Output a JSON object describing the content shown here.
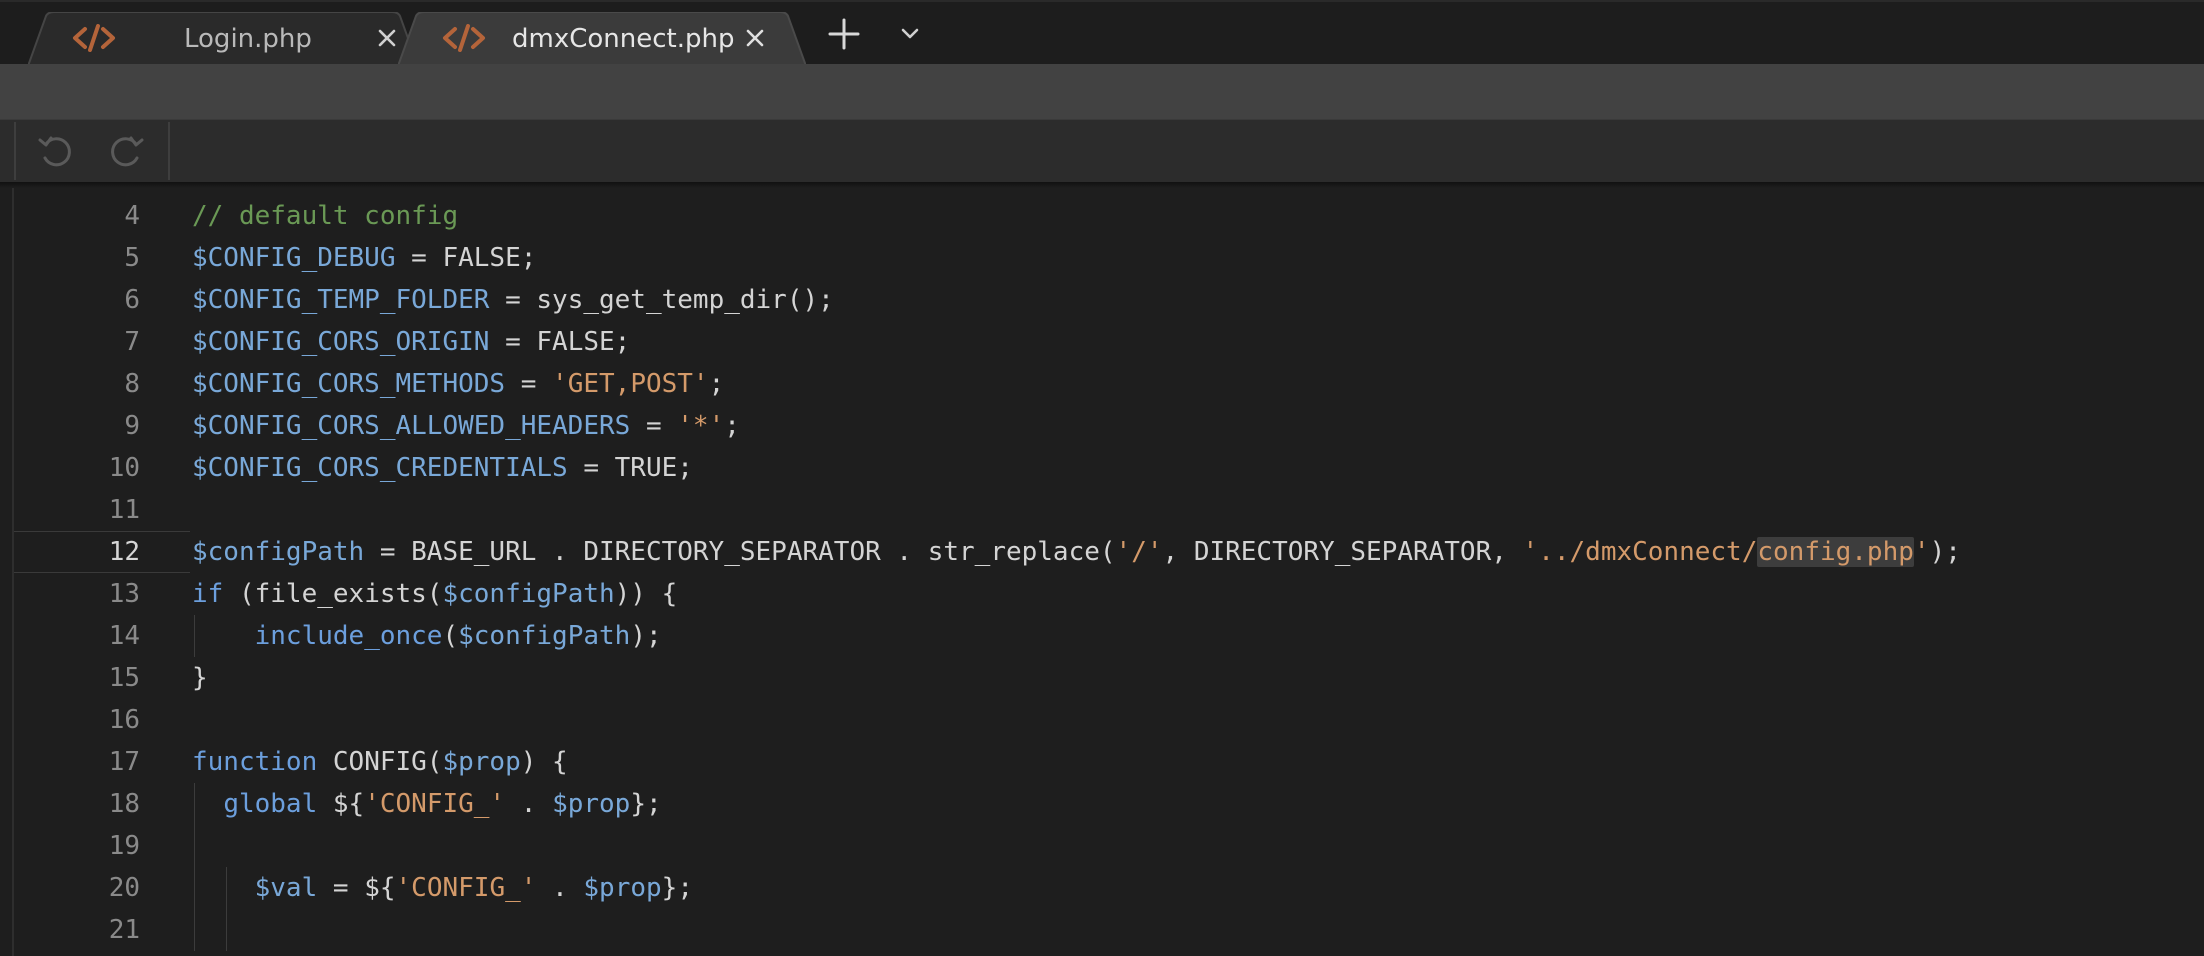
{
  "tabs": [
    {
      "title": "Login.php",
      "icon": "code-file-icon",
      "active": false
    },
    {
      "title": "dmxConnect.php",
      "icon": "code-file-icon",
      "active": true
    }
  ],
  "colors": {
    "icon_orange": "#b4643a",
    "comment": "#6a9955",
    "variable": "#79a8d8",
    "string": "#d49a6a",
    "keyword": "#6c9fdd",
    "text": "#d4d4d4"
  },
  "editor": {
    "active_line": 12,
    "lines": [
      {
        "number": "4",
        "tokens": [
          {
            "t": "// default config",
            "c": "comment"
          }
        ]
      },
      {
        "number": "5",
        "tokens": [
          {
            "t": "$CONFIG_DEBUG",
            "c": "var"
          },
          {
            "t": " = FALSE;",
            "c": "plain"
          }
        ]
      },
      {
        "number": "6",
        "tokens": [
          {
            "t": "$CONFIG_TEMP_FOLDER",
            "c": "var"
          },
          {
            "t": " = sys_get_temp_dir();",
            "c": "plain"
          }
        ]
      },
      {
        "number": "7",
        "tokens": [
          {
            "t": "$CONFIG_CORS_ORIGIN",
            "c": "var"
          },
          {
            "t": " = FALSE;",
            "c": "plain"
          }
        ]
      },
      {
        "number": "8",
        "tokens": [
          {
            "t": "$CONFIG_CORS_METHODS",
            "c": "var"
          },
          {
            "t": " = ",
            "c": "plain"
          },
          {
            "t": "'GET,POST'",
            "c": "str"
          },
          {
            "t": ";",
            "c": "plain"
          }
        ]
      },
      {
        "number": "9",
        "tokens": [
          {
            "t": "$CONFIG_CORS_ALLOWED_HEADERS",
            "c": "var"
          },
          {
            "t": " = ",
            "c": "plain"
          },
          {
            "t": "'*'",
            "c": "str"
          },
          {
            "t": ";",
            "c": "plain"
          }
        ]
      },
      {
        "number": "10",
        "tokens": [
          {
            "t": "$CONFIG_CORS_CREDENTIALS",
            "c": "var"
          },
          {
            "t": " = TRUE;",
            "c": "plain"
          }
        ]
      },
      {
        "number": "11",
        "tokens": []
      },
      {
        "number": "12",
        "tokens": [
          {
            "t": "$configPath",
            "c": "var"
          },
          {
            "t": " = BASE_URL . DIRECTORY_SEPARATOR . str_replace(",
            "c": "plain"
          },
          {
            "t": "'/'",
            "c": "str"
          },
          {
            "t": ", DIRECTORY_SEPARATOR, ",
            "c": "plain"
          },
          {
            "t": "'../dmxConnect/",
            "c": "str"
          },
          {
            "t": "config.php",
            "c": "str",
            "hl": true
          },
          {
            "t": "'",
            "c": "str"
          },
          {
            "t": ");",
            "c": "plain"
          }
        ]
      },
      {
        "number": "13",
        "tokens": [
          {
            "t": "if",
            "c": "kw"
          },
          {
            "t": " (file_exists(",
            "c": "plain"
          },
          {
            "t": "$configPath",
            "c": "var"
          },
          {
            "t": ")) {",
            "c": "plain"
          }
        ]
      },
      {
        "number": "14",
        "tokens": [
          {
            "t": "    ",
            "c": "plain"
          },
          {
            "t": "include_once",
            "c": "kw"
          },
          {
            "t": "(",
            "c": "plain"
          },
          {
            "t": "$configPath",
            "c": "var"
          },
          {
            "t": ");",
            "c": "plain"
          }
        ]
      },
      {
        "number": "15",
        "tokens": [
          {
            "t": "}",
            "c": "plain"
          }
        ]
      },
      {
        "number": "16",
        "tokens": []
      },
      {
        "number": "17",
        "tokens": [
          {
            "t": "function",
            "c": "kw"
          },
          {
            "t": " CONFIG(",
            "c": "plain"
          },
          {
            "t": "$prop",
            "c": "var"
          },
          {
            "t": ") {",
            "c": "plain"
          }
        ]
      },
      {
        "number": "18",
        "tokens": [
          {
            "t": "  ",
            "c": "plain"
          },
          {
            "t": "global",
            "c": "kw"
          },
          {
            "t": " ${",
            "c": "plain"
          },
          {
            "t": "'CONFIG_'",
            "c": "str"
          },
          {
            "t": " . ",
            "c": "plain"
          },
          {
            "t": "$prop",
            "c": "var"
          },
          {
            "t": "};",
            "c": "plain"
          }
        ]
      },
      {
        "number": "19",
        "tokens": []
      },
      {
        "number": "20",
        "tokens": [
          {
            "t": "    ",
            "c": "plain"
          },
          {
            "t": "$val",
            "c": "var"
          },
          {
            "t": " = ${",
            "c": "plain"
          },
          {
            "t": "'CONFIG_'",
            "c": "str"
          },
          {
            "t": " . ",
            "c": "plain"
          },
          {
            "t": "$prop",
            "c": "var"
          },
          {
            "t": "};",
            "c": "plain"
          }
        ]
      },
      {
        "number": "21",
        "tokens": []
      }
    ]
  }
}
